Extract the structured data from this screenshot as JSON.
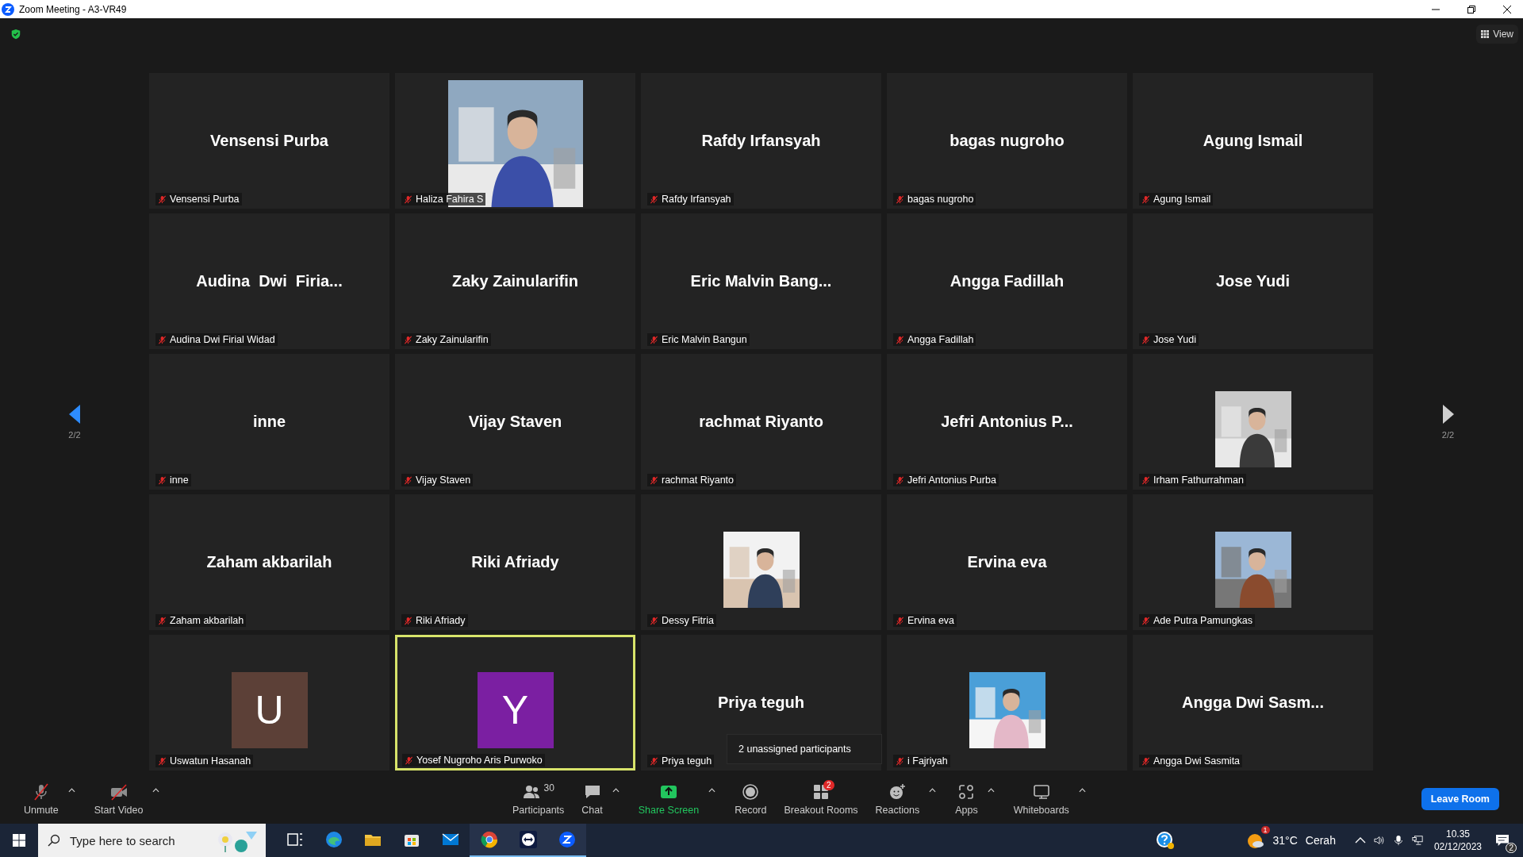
{
  "window": {
    "title": "Zoom Meeting - A3-VR49"
  },
  "view_button": {
    "label": "View"
  },
  "pager": {
    "left": "2/2",
    "right": "2/2"
  },
  "tiles": [
    {
      "kind": "name",
      "display": "Vensensi Purba",
      "label": "Vensensi Purba",
      "muted": true,
      "selected": false
    },
    {
      "kind": "photo-full",
      "label": "Haliza Fahira S",
      "muted": true,
      "selected": false
    },
    {
      "kind": "name",
      "display": "Rafdy Irfansyah",
      "label": "Rafdy Irfansyah",
      "muted": true,
      "selected": false
    },
    {
      "kind": "name",
      "display": "bagas nugroho",
      "label": "bagas nugroho",
      "muted": true,
      "selected": false
    },
    {
      "kind": "name",
      "display": "Agung Ismail",
      "label": "Agung Ismail",
      "muted": true,
      "selected": false
    },
    {
      "kind": "name",
      "display": "Audina  Dwi  Firia...",
      "label": "Audina Dwi Firial Widad",
      "muted": true,
      "selected": false
    },
    {
      "kind": "name",
      "display": "Zaky Zainularifin",
      "label": "Zaky Zainularifin",
      "muted": true,
      "selected": false
    },
    {
      "kind": "name",
      "display": "Eric Malvin Bang...",
      "label": "Eric Malvin Bangun",
      "muted": true,
      "selected": false
    },
    {
      "kind": "name",
      "display": "Angga Fadillah",
      "label": "Angga Fadillah",
      "muted": true,
      "selected": false
    },
    {
      "kind": "name",
      "display": "Jose Yudi",
      "label": "Jose Yudi",
      "muted": true,
      "selected": false
    },
    {
      "kind": "name",
      "display": "inne",
      "label": "inne",
      "muted": true,
      "selected": false
    },
    {
      "kind": "name",
      "display": "Vijay Staven",
      "label": "Vijay Staven",
      "muted": true,
      "selected": false
    },
    {
      "kind": "name",
      "display": "rachmat Riyanto",
      "label": "rachmat Riyanto",
      "muted": true,
      "selected": false
    },
    {
      "kind": "name",
      "display": "Jefri Antonius P...",
      "label": "Jefri Antonius Purba",
      "muted": true,
      "selected": false
    },
    {
      "label": "Irham Fathurrahman",
      "muted": true,
      "selected": false
    },
    {
      "kind": "name",
      "display": "Zaham akbarilah",
      "label": "Zaham akbarilah",
      "muted": true,
      "selected": false
    },
    {
      "kind": "name",
      "display": "Riki Afriady",
      "label": "Riki Afriady",
      "muted": true,
      "selected": false
    },
    {
      "label": "Dessy Fitria",
      "muted": true,
      "selected": false
    },
    {
      "kind": "name",
      "display": "Ervina eva",
      "label": "Ervina eva",
      "muted": true,
      "selected": false
    },
    {
      "label": "Ade Putra Pamungkas",
      "muted": true,
      "selected": false
    },
    {
      "kind": "initial",
      "initial": "U",
      "color": "#5c4037",
      "label": "Uswatun Hasanah",
      "muted": true,
      "selected": false
    },
    {
      "kind": "initial",
      "initial": "Y",
      "color": "#7b1fa2",
      "label": "Yosef Nugroho Aris Purwoko",
      "muted": true,
      "selected": true
    },
    {
      "kind": "name",
      "display": "Priya teguh",
      "label": "Priya teguh",
      "muted": true,
      "selected": false
    },
    {
      "label": "i Fajriyah",
      "muted": true,
      "selected": false
    },
    {
      "kind": "name",
      "display": "Angga Dwi Sasm...",
      "label": "Angga Dwi Sasmita",
      "muted": true,
      "selected": false
    }
  ],
  "tooltip": {
    "text": "2 unassigned participants"
  },
  "toolbar": {
    "left": [
      {
        "kind": "mic",
        "label": "Unmute",
        "caret": true,
        "highlighted": false
      },
      {
        "kind": "video",
        "label": "Start Video",
        "caret": true,
        "highlighted": false
      }
    ],
    "center": [
      {
        "kind": "participants",
        "label": "Participants",
        "count": "30",
        "caret": false,
        "highlighted": false
      },
      {
        "kind": "chat",
        "label": "Chat",
        "caret": true,
        "highlighted": false
      },
      {
        "kind": "share",
        "label": "Share Screen",
        "caret": true,
        "highlighted": true
      },
      {
        "kind": "record",
        "label": "Record",
        "caret": false,
        "highlighted": false
      },
      {
        "kind": "breakout",
        "label": "Breakout Rooms",
        "badge": "2",
        "caret": false,
        "highlighted": false
      },
      {
        "kind": "reactions",
        "label": "Reactions",
        "caret": true,
        "highlighted": false
      },
      {
        "kind": "apps",
        "label": "Apps",
        "caret": true,
        "highlighted": false
      },
      {
        "kind": "whiteboard",
        "label": "Whiteboards",
        "caret": true,
        "highlighted": false
      }
    ],
    "leave": "Leave Room"
  },
  "taskbar": {
    "search_placeholder": "Type here to search",
    "apps": [
      {
        "running": false
      },
      {
        "running": false
      },
      {
        "running": false
      },
      {
        "running": false
      },
      {
        "running": false
      },
      {
        "running": true
      },
      {
        "running": true
      },
      {
        "running": true
      }
    ],
    "weather_badge": "1",
    "temperature": "31°C",
    "weather": "Cerah",
    "time": "10.35",
    "date": "02/12/2023",
    "notifications": "2"
  }
}
